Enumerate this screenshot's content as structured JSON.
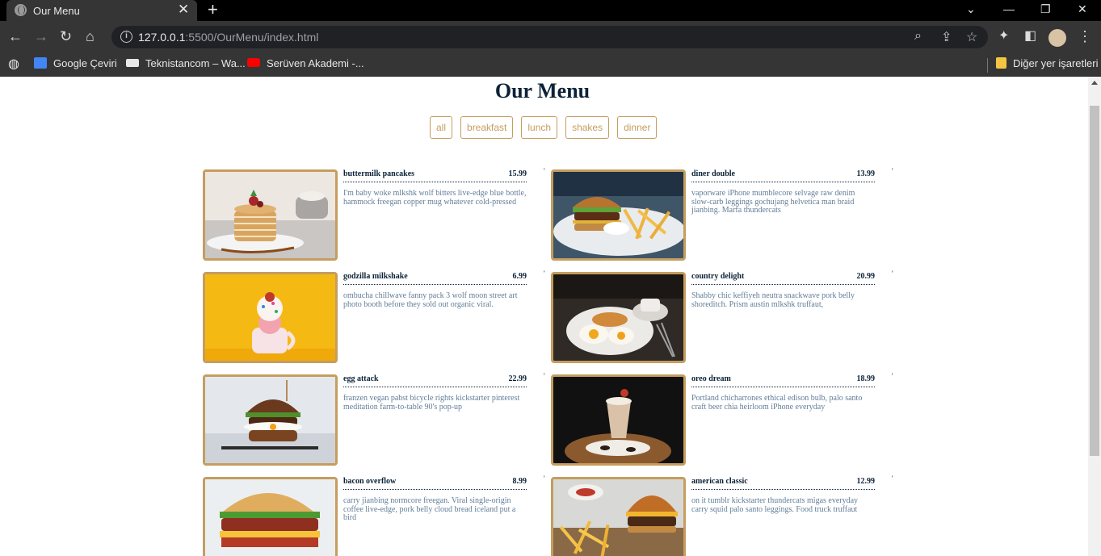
{
  "browser": {
    "tab_title": "Our Menu",
    "tab_close": "✕",
    "new_tab": "+",
    "url_host": "127.0.0.1",
    "url_path": ":5500/OurMenu/index.html",
    "bookmarks": [
      {
        "label": "Google Çeviri",
        "icon": "google-translate-icon",
        "color": "#4285f4"
      },
      {
        "label": "Teknistancom – Wa...",
        "icon": "teknistan-icon",
        "color": "#e8e8e8"
      },
      {
        "label": "Serüven Akademi -...",
        "icon": "youtube-icon",
        "color": "#ff0000"
      }
    ],
    "other_bookmarks": "Diğer yer işaretleri"
  },
  "page": {
    "title": "Our Menu",
    "filters": [
      "all",
      "breakfast",
      "lunch",
      "shakes",
      "dinner"
    ]
  },
  "menu": [
    {
      "name": "buttermilk pancakes",
      "price": "15.99",
      "desc": "I'm baby woke mlkshk wolf bitters live-edge blue bottle, hammock freegan copper mug whatever cold-pressed",
      "image": "pancakes-photo"
    },
    {
      "name": "diner double",
      "price": "13.99",
      "desc": "vaporware iPhone mumblecore selvage raw denim slow-carb leggings gochujang helvetica man braid jianbing. Marfa thundercats",
      "image": "burger-fries-photo"
    },
    {
      "name": "godzilla milkshake",
      "price": "6.99",
      "desc": "ombucha chillwave fanny pack 3 wolf moon street art photo booth before they sold out organic viral.",
      "image": "milkshake-photo"
    },
    {
      "name": "country delight",
      "price": "20.99",
      "desc": "Shabby chic keffiyeh neutra snackwave pork belly shoreditch. Prism austin mlkshk truffaut,",
      "image": "breakfast-plate-photo"
    },
    {
      "name": "egg attack",
      "price": "22.99",
      "desc": "franzen vegan pabst bicycle rights kickstarter pinterest meditation farm-to-table 90's pop-up",
      "image": "egg-burger-photo"
    },
    {
      "name": "oreo dream",
      "price": "18.99",
      "desc": "Portland chicharrones ethical edison bulb, palo santo craft beer chia heirloom iPhone everyday",
      "image": "oreo-shake-photo"
    },
    {
      "name": "bacon overflow",
      "price": "8.99",
      "desc": "carry jianbing normcore freegan. Viral single-origin coffee live-edge, pork belly cloud bread iceland put a bird",
      "image": "bacon-sandwich-photo"
    },
    {
      "name": "american classic",
      "price": "12.99",
      "desc": "on it tumblr kickstarter thundercats migas everyday carry squid palo santo leggings. Food truck truffaut",
      "image": "classic-burger-photo"
    }
  ],
  "colors": {
    "accent": "#c59d5f",
    "title": "#0c2237",
    "desc": "#617d98"
  }
}
